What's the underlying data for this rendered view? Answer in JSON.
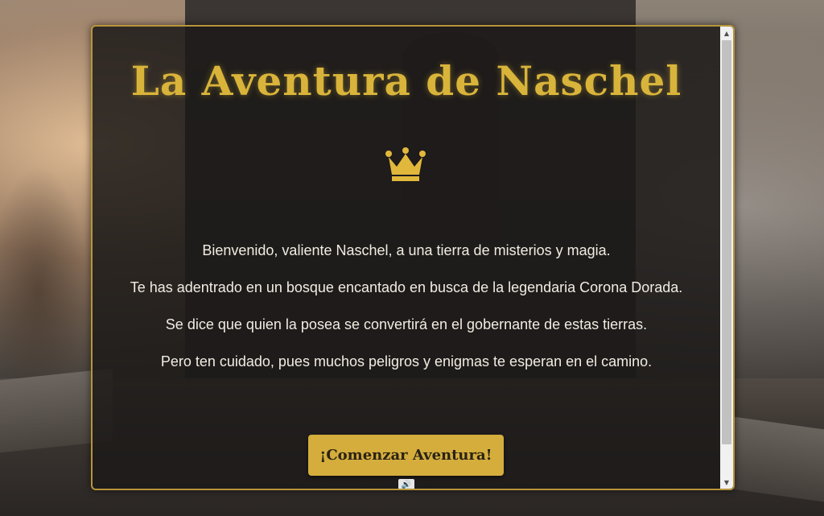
{
  "game": {
    "title": "La Aventura de Naschel",
    "crown_icon": "crown-icon",
    "paragraphs": [
      "Bienvenido, valiente Naschel, a una tierra de misterios y magia.",
      "Te has adentrado en un bosque encantado en busca de la legendaria Corona Dorada.",
      "Se dice que quien la posea se convertirá en el gobernante de estas tierras.",
      "Pero ten cuidado, pues muchos peligros y enigmas te esperan en el camino."
    ],
    "start_button": "¡Comenzar Aventura!",
    "sound_icon": "speaker-icon",
    "sound_glyph": "🔊"
  },
  "scrollbar": {
    "up_glyph": "▲",
    "down_glyph": "▼"
  },
  "colors": {
    "accent": "#d9b43a",
    "button": "#d4ad3c",
    "border": "#b8953a",
    "text": "#f1ece2"
  }
}
